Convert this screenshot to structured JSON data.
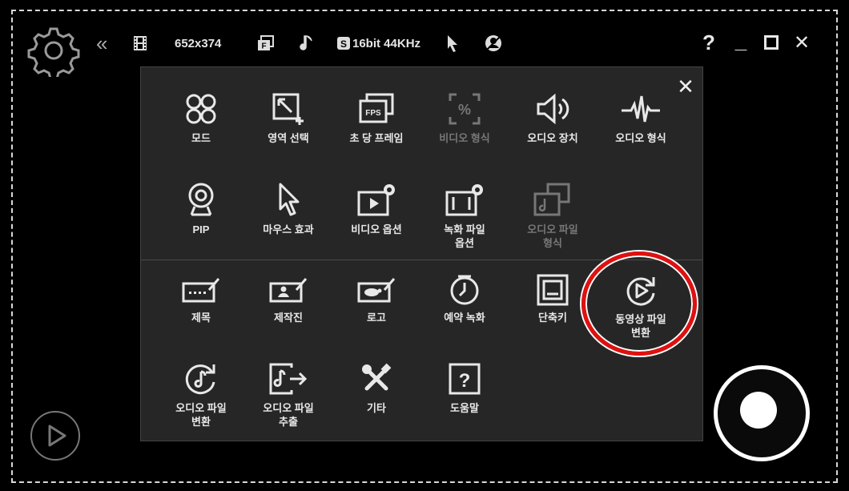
{
  "toolbar": {
    "resolution": "652x374",
    "audio_format": "16bit 44KHz"
  },
  "window": {
    "help": "?",
    "minimize": "_",
    "maximize": "□",
    "close": "✕"
  },
  "panel": {
    "close": "✕",
    "row1": [
      {
        "label": "모드",
        "icon": "mode-icon",
        "enabled": true
      },
      {
        "label": "영역 선택",
        "icon": "area-select-icon",
        "enabled": true
      },
      {
        "label": "초 당 프레임",
        "icon": "fps-icon",
        "enabled": true
      },
      {
        "label": "비디오 형식",
        "icon": "video-format-icon",
        "enabled": false
      },
      {
        "label": "오디오 장치",
        "icon": "audio-device-icon",
        "enabled": true
      },
      {
        "label": "오디오 형식",
        "icon": "audio-format-icon",
        "enabled": true
      }
    ],
    "row2": [
      {
        "label": "PIP",
        "icon": "webcam-icon",
        "enabled": true
      },
      {
        "label": "마우스 효과",
        "icon": "cursor-icon",
        "enabled": true
      },
      {
        "label": "비디오 옵션",
        "icon": "video-options-icon",
        "enabled": true
      },
      {
        "label": "녹화 파일\n옵션",
        "icon": "record-file-options-icon",
        "enabled": true
      },
      {
        "label": "오디오 파일\n형식",
        "icon": "audio-file-format-icon",
        "enabled": false
      }
    ],
    "row3": [
      {
        "label": "제목",
        "icon": "title-icon",
        "enabled": true
      },
      {
        "label": "제작진",
        "icon": "credits-icon",
        "enabled": true
      },
      {
        "label": "로고",
        "icon": "logo-icon",
        "enabled": true
      },
      {
        "label": "예약 녹화",
        "icon": "clock-icon",
        "enabled": true
      },
      {
        "label": "단축키",
        "icon": "hotkey-icon",
        "enabled": true
      },
      {
        "label": "동영상 파일\n변환",
        "icon": "video-convert-icon",
        "enabled": true
      }
    ],
    "row4": [
      {
        "label": "오디오 파일\n변환",
        "icon": "audio-convert-icon",
        "enabled": true
      },
      {
        "label": "오디오 파일\n추출",
        "icon": "audio-extract-icon",
        "enabled": true
      },
      {
        "label": "기타",
        "icon": "tools-icon",
        "enabled": true
      },
      {
        "label": "도움말",
        "icon": "help-icon",
        "enabled": true
      }
    ]
  },
  "colors": {
    "background": "#000000",
    "panel": "#262626",
    "highlight": "#e01010",
    "disabled_text": "#777777"
  }
}
